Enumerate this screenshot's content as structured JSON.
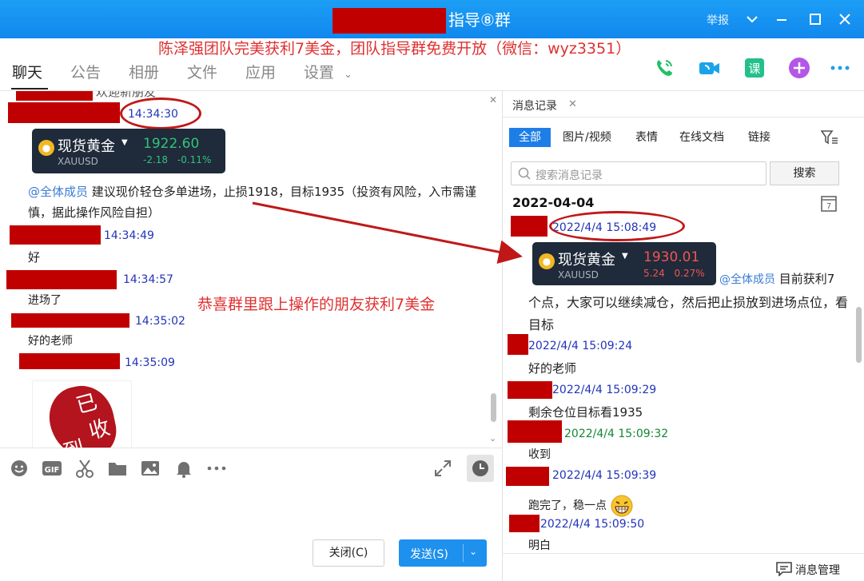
{
  "window": {
    "title": "指导⑧群",
    "report": "举报",
    "icons": [
      "chevron-down-icon",
      "minimize-icon",
      "maximize-icon",
      "close-icon"
    ]
  },
  "banner": "陈泽强团队完美获利7美金，团队指导群免费开放（微信：wyz3351）",
  "nav": {
    "tabs": [
      "聊天",
      "公告",
      "相册",
      "文件",
      "应用"
    ],
    "settings": "设置",
    "right_icons": [
      "phone-icon",
      "video-icon",
      "lesson-icon",
      "add-icon",
      "more-icon"
    ],
    "lesson_char": "课"
  },
  "chat": {
    "partial_top": "欢迎新朋友",
    "times": [
      "14:34:30",
      "14:34:49",
      "14:34:57",
      "14:35:02",
      "14:35:09"
    ],
    "gold_card": {
      "name": "现货黄金",
      "code": "XAUUSD",
      "price": "1922.60",
      "change": "-2.18",
      "change_pct": "-0.11%"
    },
    "mention": "@全体成员",
    "message_1": "建议现价轻仓多单进场，止损1918，目标1935（投资有风险，入市需谨慎，据此操作风险自担）",
    "message_2": "好",
    "message_3": "进场了",
    "message_4": "好的老师",
    "congrats": "恭喜群里跟上操作的朋友获利7美金",
    "stamp_chars": [
      "已",
      "收",
      "到"
    ]
  },
  "toolbar": {
    "icons": [
      "emoji-icon",
      "gif-icon",
      "scissors-icon",
      "folder-icon",
      "image-icon",
      "bell-icon",
      "more-icon"
    ],
    "gif_label": "GIF",
    "close_btn": "关闭(C)",
    "send_btn": "发送(S)"
  },
  "panel": {
    "tab": "消息记录",
    "filters": [
      "全部",
      "图片/视频",
      "表情",
      "在线文档",
      "链接"
    ],
    "search_placeholder": "搜索消息记录",
    "search_btn": "搜索",
    "date": "2022-04-04",
    "calendar_day": "7",
    "gold_card": {
      "name": "现货黄金",
      "code": "XAUUSD",
      "price": "1930.01",
      "change": "5.24",
      "change_pct": "0.27%"
    },
    "times": [
      "2022/4/4 15:08:49",
      "2022/4/4 15:09:24",
      "2022/4/4 15:09:29",
      "2022/4/4 15:09:32",
      "2022/4/4 15:09:39",
      "2022/4/4 15:09:50"
    ],
    "mention": "@全体成员",
    "message_1_first": "目前获利7",
    "message_1_rest": "个点，大家可以继续减仓，然后把止损放到进场点位，看目标",
    "message_2": "好的老师",
    "message_3": "剩余仓位目标看1935",
    "message_4": "收到",
    "message_5": "跑完了，稳一点",
    "message_6": "明白",
    "footer": "消息管理"
  },
  "colors": {
    "titlebar": "#1188ee",
    "redaction": "#c00000",
    "annotation": "#e03030",
    "timestamp": "#2233bb",
    "timestamp_green": "#118833",
    "price_up": "#ef5555",
    "price_down": "#33c27a"
  }
}
